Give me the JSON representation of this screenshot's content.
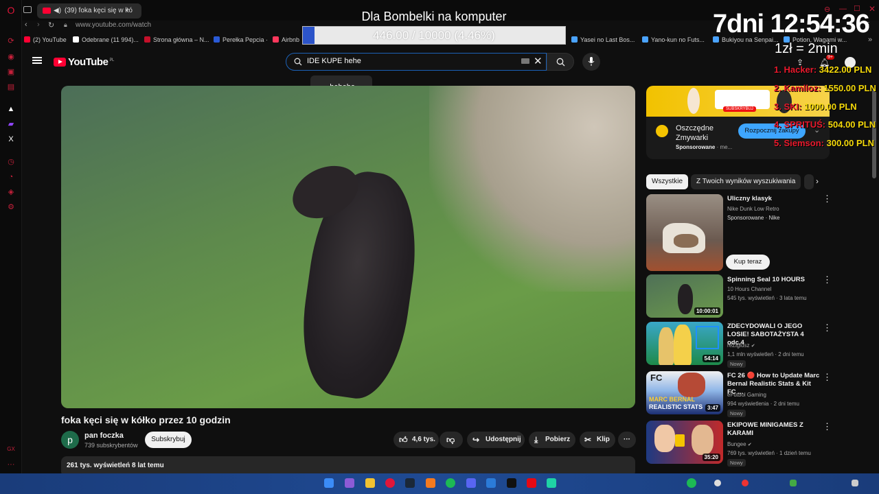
{
  "browser": {
    "tab_title": "(39) foka kęci się w kó",
    "url": "www.youtube.com/watch",
    "bookmarks": [
      "(2) YouTube",
      "Odebrane (11 994)...",
      "Strona główna – N...",
      "Perełka Pepcia ·",
      "Airbnb",
      "Yasei no Last Bos...",
      "Yano-kun no Futs...",
      "Bukiyou na Senpai...",
      "Potion, Wagami w..."
    ]
  },
  "overlay": {
    "title": "Dla Bombelki na komputer",
    "progress_text": "446.00 / 10000 (4.46%)",
    "progress_fraction": 0.0446,
    "timer": "7dni 12:54:36",
    "rate": "1zł = 2min",
    "leaderboard": [
      {
        "rank": "1.",
        "name": "Hacker:",
        "amount": "3422.00 PLN"
      },
      {
        "rank": "2.",
        "name": "Kamlloz:",
        "amount": "1550.00 PLN"
      },
      {
        "rank": "3.",
        "name": "SKI:",
        "amount": "1000.00 PLN"
      },
      {
        "rank": "4.",
        "name": "SPRITUŚ:",
        "amount": "504.00 PLN"
      },
      {
        "rank": "5.",
        "name": "Siemson:",
        "amount": "300.00 PLN"
      }
    ]
  },
  "youtube": {
    "logo_text": "YouTube",
    "logo_region": "PL",
    "search_value": "IDE KUPE hehe",
    "suggestion": "... hehehe",
    "notification_count": "9+"
  },
  "video": {
    "title": "foka kęci się w kółko przez 10 godzin",
    "channel_initial": "p",
    "channel_name": "pan foczka",
    "channel_subs": "739 subskrybentów",
    "subscribe_label": "Subskrybuj",
    "likes": "4,6 tys.",
    "share_label": "Udostępnij",
    "download_label": "Pobierz",
    "clip_label": "Klip",
    "views_date": "261 tys. wyświetleń  8 lat temu"
  },
  "ad": {
    "title": "Oszczędne Zmywarki",
    "meta": "Sponsorowane",
    "meta_suffix": "· me...",
    "cta": "Rozpocznij zakupy",
    "subscribe_tag": "SUBSKRYBUJ"
  },
  "chips": [
    "Wszystkie",
    "Z Twoich wyników wyszukiwania"
  ],
  "recommendations": [
    {
      "title": "Uliczny klasyk",
      "line1": "Nike Dunk Low Retro",
      "line2": "Sponsorowane · Nike",
      "cta": "Kup teraz",
      "duration": "",
      "badge": ""
    },
    {
      "title": "Spinning Seal  10 HOURS",
      "line1": "10 Hours Channel",
      "line2": "545 tys. wyświetleń · 3 lata temu",
      "duration": "10:00:01",
      "badge": ""
    },
    {
      "title": "ZDECYDOWALI O JEGO LOSIE! SABOTAŻYSTA 4 odc.4",
      "line1": "reZigiusz",
      "line2": "1,1 mln wyświetleń · 2 dni temu",
      "duration": "54:14",
      "badge": "Nowy"
    },
    {
      "title": "FC 26 🔴 How to Update Marc Bernal Realistic Stats & Kit FC ...",
      "line1": "eFutbol Gaming",
      "line2": "994 wyświetlenia · 2 dni temu",
      "duration": "3:47",
      "badge": "Nowy"
    },
    {
      "title": "EKIPOWE MINIGAMES Z KARAMI",
      "line1": "Bungee",
      "line2": "769 tys. wyświetleń · 1 dzień temu",
      "duration": "35:20",
      "badge": "Nowy"
    }
  ],
  "thumb_text": {
    "fc_title": "MARC BERNAL",
    "fc_subtitle": "REALISTIC STATS"
  },
  "colors": {
    "yt_red": "#ff0033",
    "opera_red": "#c4203a",
    "progress_blue": "#2c54c9",
    "leaderboard_rank": "#e8192c",
    "leaderboard_amount": "#f5d90a",
    "ad_cta": "#3ea6ff"
  }
}
